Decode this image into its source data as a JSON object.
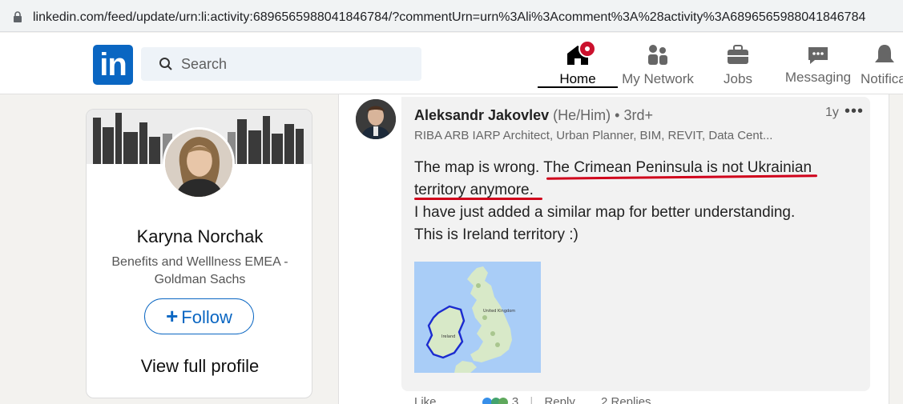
{
  "browser": {
    "url": "linkedin.com/feed/update/urn:li:activity:6896565988041846784/?commentUrn=urn%3Ali%3Acomment%3A%28activity%3A6896565988041846784"
  },
  "nav": {
    "logo_text": "in",
    "search_placeholder": "Search",
    "items": [
      {
        "label": "Home",
        "icon": "home-icon"
      },
      {
        "label": "My Network",
        "icon": "people-icon"
      },
      {
        "label": "Jobs",
        "icon": "briefcase-icon"
      },
      {
        "label": "Messaging",
        "icon": "chat-icon"
      },
      {
        "label": "Notifica",
        "icon": "bell-icon"
      }
    ],
    "brand_color": "#0a66c2"
  },
  "profile": {
    "name": "Karyna Norchak",
    "headline": "Benefits and Welllness EMEA - Goldman Sachs",
    "follow_label": "Follow",
    "view_profile_label": "View full profile"
  },
  "comment": {
    "author": "Aleksandr Jakovlev",
    "pronouns": "(He/Him)",
    "degree": "• 3rd+",
    "headline": "RIBA ARB IARP Architect, Urban Planner, BIM, REVIT, Data Cent...",
    "time": "1y",
    "more": "•••",
    "text_line1_a": "The map is wrong. ",
    "text_line1_b": "The Crimean Peninsula is not Ukrainian",
    "text_line2": "territory anymore.",
    "text_line3": "I have just added a similar map for better understanding.",
    "text_line4": "This is Ireland territory :)",
    "map_labels": {
      "uk": "United Kingdom",
      "ireland": "Ireland"
    },
    "annotation_color": "#d0021b"
  },
  "actions": {
    "like": "Like",
    "reaction_count": "3",
    "reply": "Reply",
    "replies": "2 Replies"
  }
}
